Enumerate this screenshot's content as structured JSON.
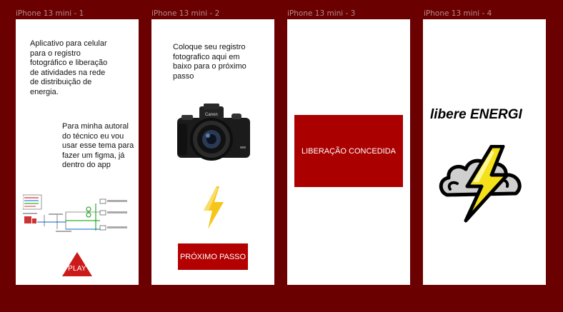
{
  "frames": [
    {
      "label": "iPhone 13 mini - 1"
    },
    {
      "label": "iPhone 13 mini - 2"
    },
    {
      "label": "iPhone 13 mini - 3"
    },
    {
      "label": "iPhone 13 mini - 4"
    }
  ],
  "screen1": {
    "intro_text": "Aplicativo para celular para o registro fotográfico e liberação de atividades na rede de distribuição de energia.",
    "note_text": "Para minha autoral do técnico eu vou usar esse tema para fazer um figma, já dentro do app",
    "play_label": "PLAY",
    "play_color": "#cc1a1a",
    "diagram_icon": "power-distribution-diagram"
  },
  "screen2": {
    "instruction_text": "Coloque seu registro fotografico aqui em baixo para o próximo passo",
    "camera_icon": "camera-icon",
    "camera_brand": "Canon",
    "bolt_color": "#f5c518",
    "next_button_label": "PRÓXIMO PASSO",
    "button_color": "#b30000"
  },
  "screen3": {
    "banner_text": "LIBERAÇÃO CONCEDIDA",
    "banner_color": "#aa0000"
  },
  "screen4": {
    "logo_text": "libere ENERGI",
    "storm_icon": "storm-cloud-lightning-icon"
  },
  "colors": {
    "canvas": "#6b0000",
    "frame": "#ffffff",
    "accent": "#b30000"
  }
}
